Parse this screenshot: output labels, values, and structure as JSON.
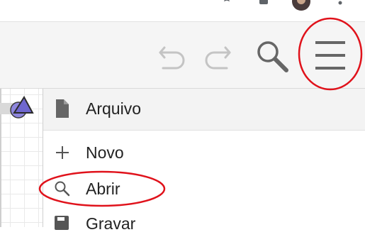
{
  "toolbar": {
    "undo_icon": "undo-icon",
    "redo_icon": "redo-icon",
    "search_icon": "search-icon",
    "menu_icon": "hamburger-menu-icon"
  },
  "menu": {
    "header": {
      "label": "Arquivo",
      "icon": "file-icon"
    },
    "items": [
      {
        "label": "Novo",
        "icon": "plus-icon"
      },
      {
        "label": "Abrir",
        "icon": "search-icon"
      },
      {
        "label": "Gravar",
        "icon": "save-icon"
      }
    ]
  },
  "colors": {
    "annotation": "#e0121b",
    "toolbar_bg": "#f5f5f5",
    "menu_header_bg": "#f3f3f3",
    "icon_gray": "#666666",
    "icon_light": "#bdbdbd",
    "tool_purple": "#7b73d1"
  }
}
